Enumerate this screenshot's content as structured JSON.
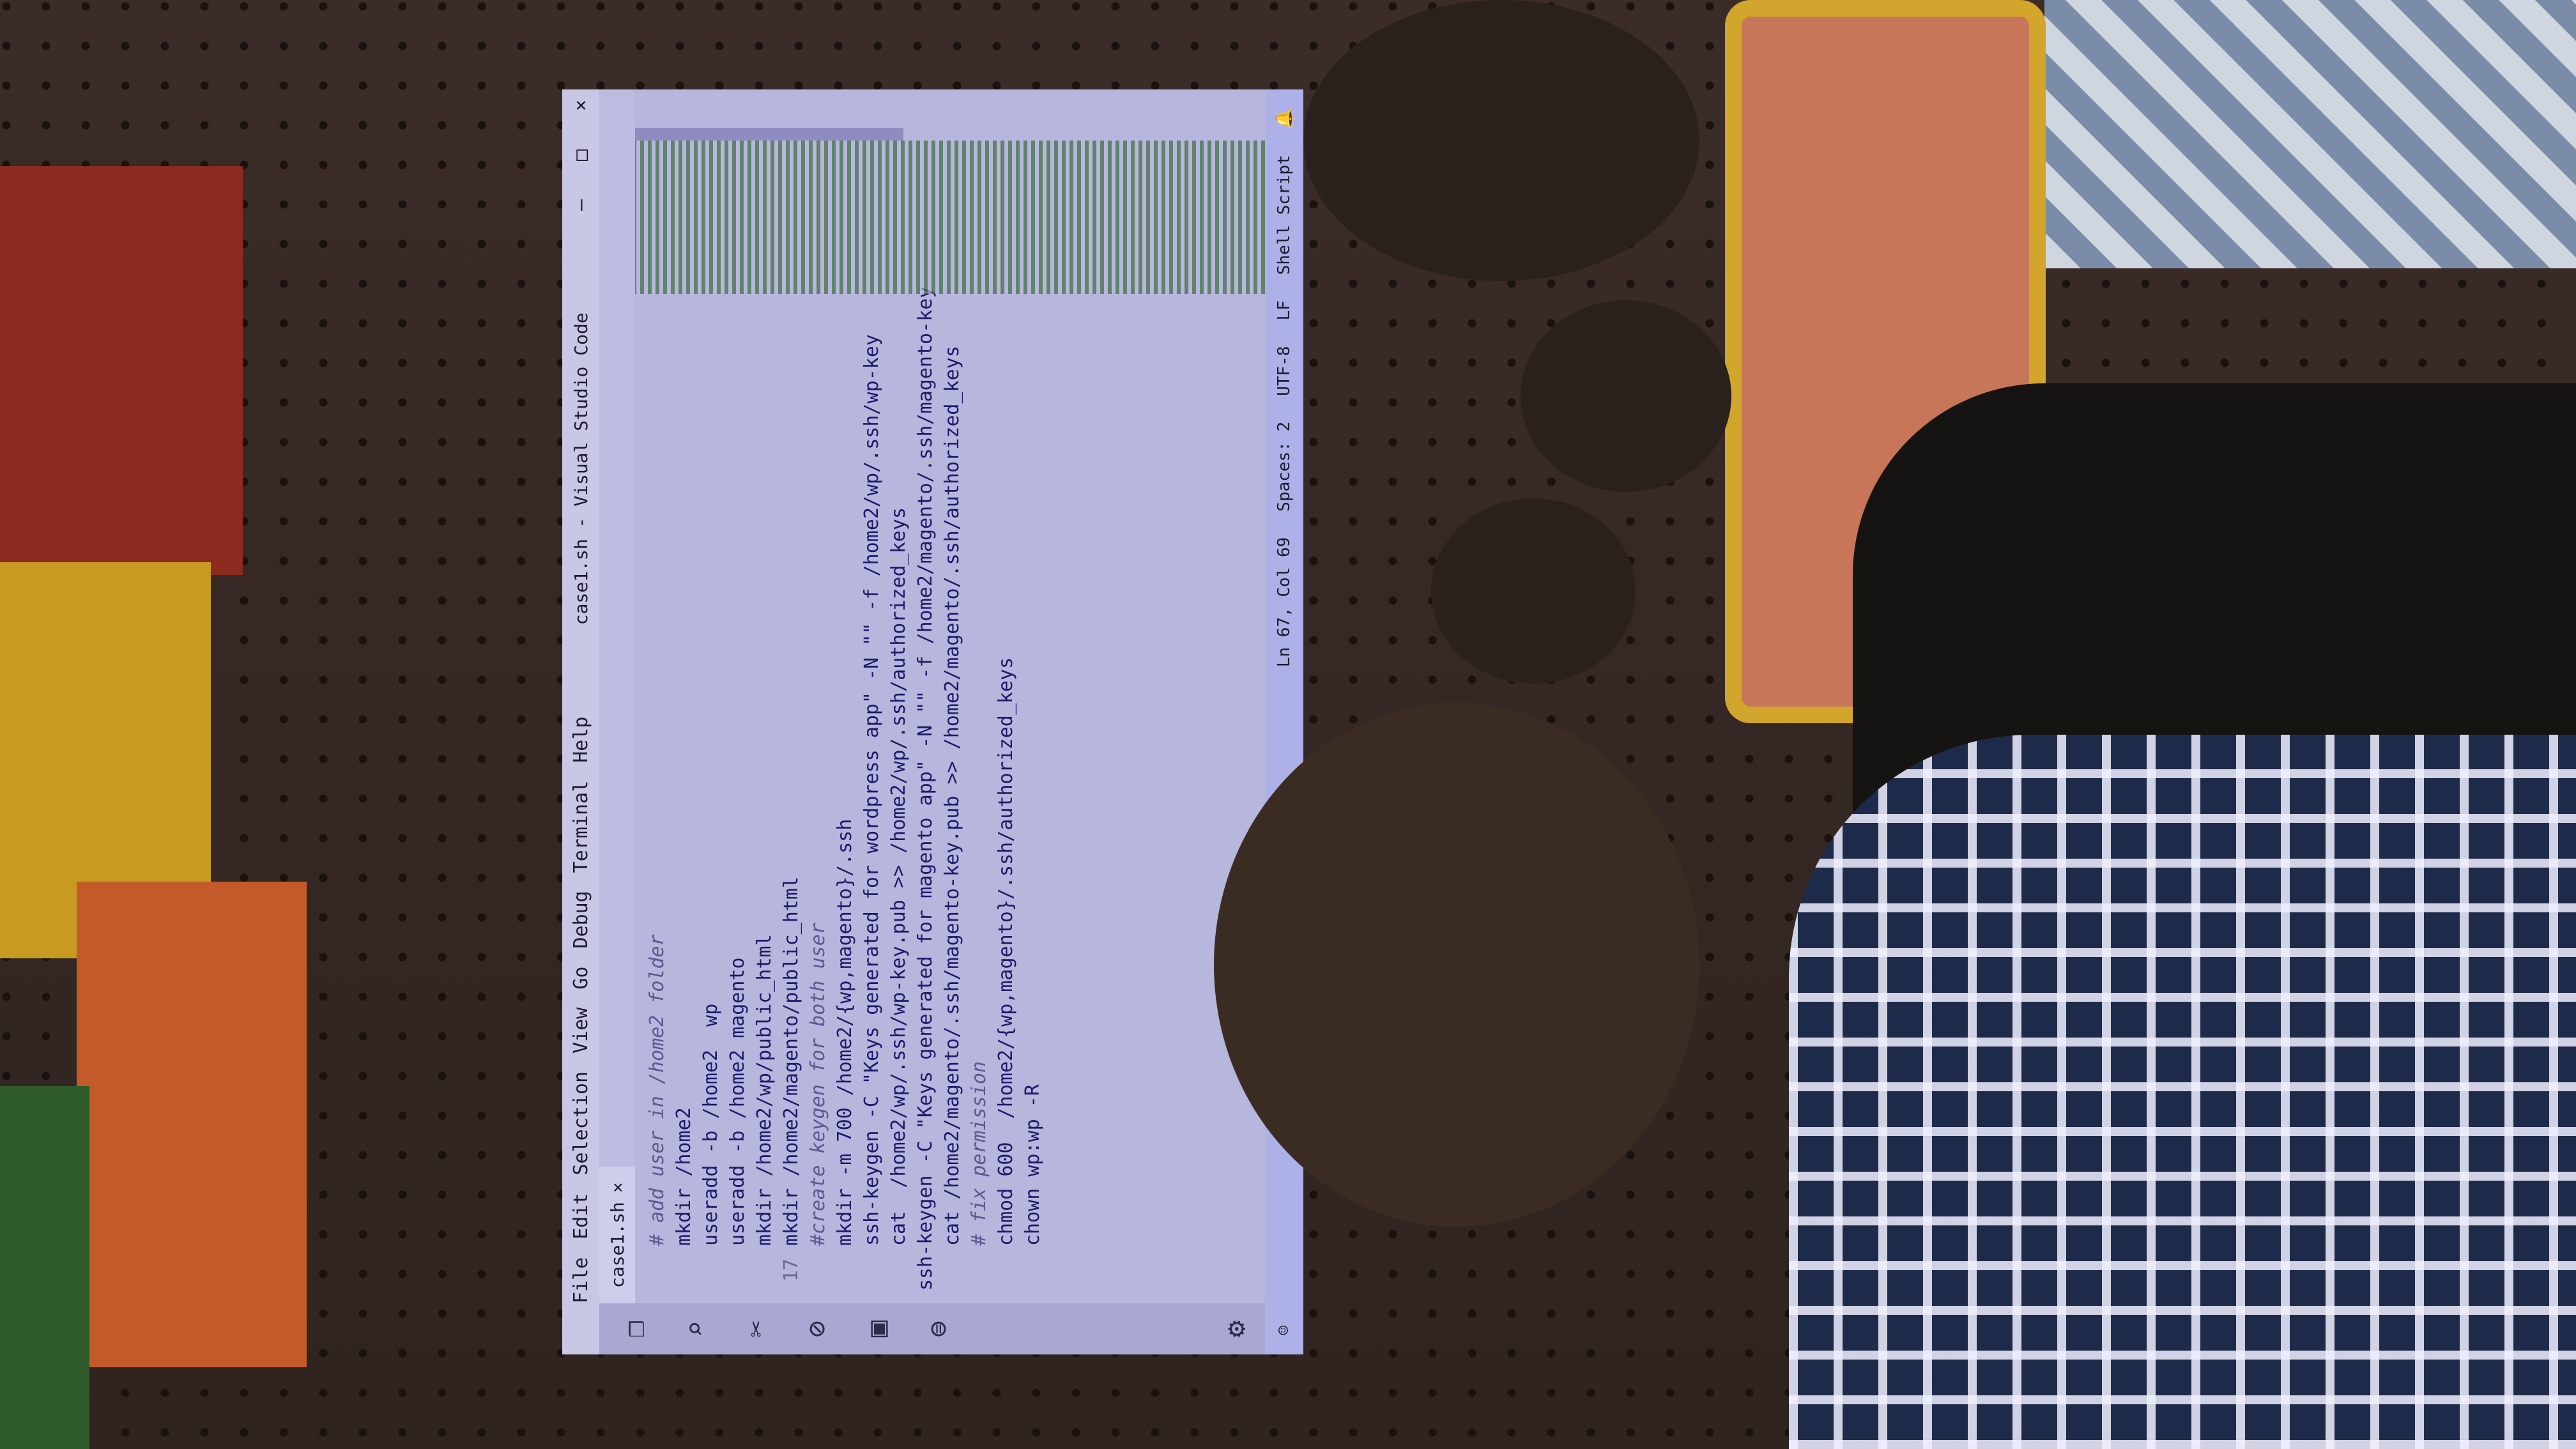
{
  "window": {
    "title": "case1.sh - Visual Studio Code",
    "menu": [
      "File",
      "Edit",
      "Selection",
      "View",
      "Go",
      "Debug",
      "Terminal",
      "Help"
    ],
    "controls": {
      "minimize": "—",
      "maximize": "□",
      "close": "×"
    }
  },
  "activity_bar": {
    "icons": [
      "files-icon",
      "search-icon",
      "source-control-icon",
      "debug-icon",
      "extensions-icon",
      "live-share-icon"
    ],
    "settings_icon": "gear-icon"
  },
  "tab": {
    "label": "case1.sh",
    "close": "×"
  },
  "code": {
    "lines": [
      {
        "text": "# add user in /home2 folder",
        "comment": true
      },
      {
        "text": "mkdir /home2",
        "comment": false
      },
      {
        "text": "useradd -b /home2  wp",
        "comment": false
      },
      {
        "text": "useradd -b /home2 magento",
        "comment": false
      },
      {
        "text": "",
        "comment": false
      },
      {
        "text": "mkdir /home2/wp/public_html",
        "comment": false
      },
      {
        "text": "mkdir /home2/magento/public_html",
        "comment": false
      },
      {
        "text": "",
        "comment": false
      },
      {
        "text": "#create keygen for both user",
        "comment": true
      },
      {
        "text": "",
        "comment": false
      },
      {
        "text": "mkdir -m 700 /home2/{wp,magento}/.ssh",
        "comment": false
      },
      {
        "text": "",
        "comment": false
      },
      {
        "text": "ssh-keygen -C \"Keys generated for wordpress app\" -N \"\" -f /home2/wp/.ssh/wp-key",
        "comment": false
      },
      {
        "text": "cat  /home2/wp/.ssh/wp-key.pub >> /home2/wp/.ssh/authorized_keys",
        "comment": false
      },
      {
        "text": "",
        "comment": false
      },
      {
        "text": "ssh-keygen -C \"Keys generated for magento app\" -N \"\" -f /home2/magento/.ssh/magento-key",
        "comment": false
      },
      {
        "text": "cat /home2/magento/.ssh/magento-key.pub >> /home2/magento/.ssh/authorized_keys",
        "comment": false
      },
      {
        "text": "",
        "comment": false
      },
      {
        "text": "# fix permission",
        "comment": true
      },
      {
        "text": "chmod 600  /home2/{wp,magento}/.ssh/authorized_keys",
        "comment": false
      },
      {
        "text": "chown wp:wp -R",
        "comment": false
      }
    ],
    "visible_line_number": "17"
  },
  "statusbar": {
    "position": "Ln 67, Col 69",
    "spaces": "Spaces: 2",
    "encoding": "UTF-8",
    "eol": "LF",
    "language": "Shell Script"
  }
}
